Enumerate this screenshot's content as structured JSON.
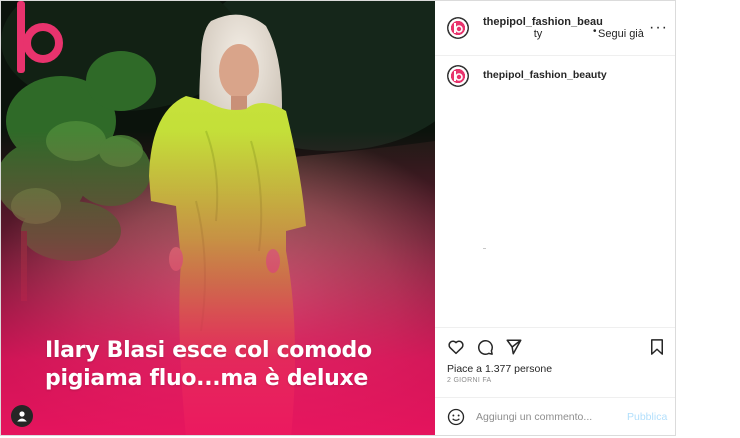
{
  "post": {
    "headline": {
      "line1": "Ilary Blasi esce col comodo",
      "line2": "pigiama fluo...ma è deluxe"
    },
    "brand_logo_letter": "b"
  },
  "header": {
    "username_line1": "thepipol_fashion_beau",
    "username_line2": "ty",
    "separator": "•",
    "follow_label": "Segui già",
    "more_label": "···"
  },
  "caption": {
    "username": "thepipol_fashion_beauty"
  },
  "actions": {
    "likes_text": "Piace a 1.377 persone",
    "date_text": "2 GIORNI FA"
  },
  "comment": {
    "placeholder": "Aggiungi un commento...",
    "publish_label": "Pubblica"
  },
  "colors": {
    "brand_pink": "#e8336d",
    "publish_blue": "#b2dffc"
  }
}
